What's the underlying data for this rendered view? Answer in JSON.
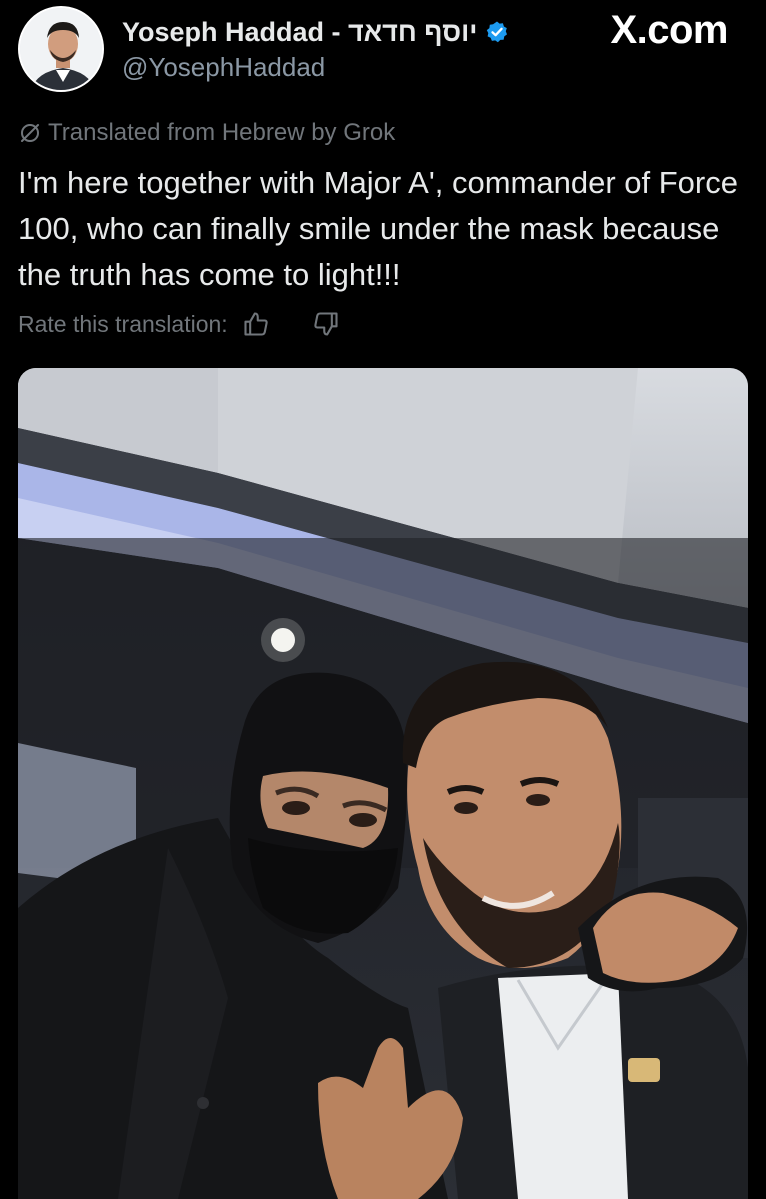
{
  "header": {
    "display_name": "Yoseph Haddad - יוסף חדאד",
    "handle": "@YosephHaddad",
    "site": "X.com",
    "verified_color": "#1d9bf0"
  },
  "translation": {
    "label": "Translated from Hebrew by Grok",
    "rate_label": "Rate this translation:",
    "icons": [
      "grok-icon",
      "thumbs-up-icon",
      "thumbs-down-icon"
    ]
  },
  "tweet": {
    "text": "I'm here together with Major A', commander of Force 100, who can finally smile under the mask because the truth has come to light!!!"
  },
  "colors": {
    "background": "#000000",
    "text": "#e7e9ea",
    "secondary_text": "#71767b"
  }
}
